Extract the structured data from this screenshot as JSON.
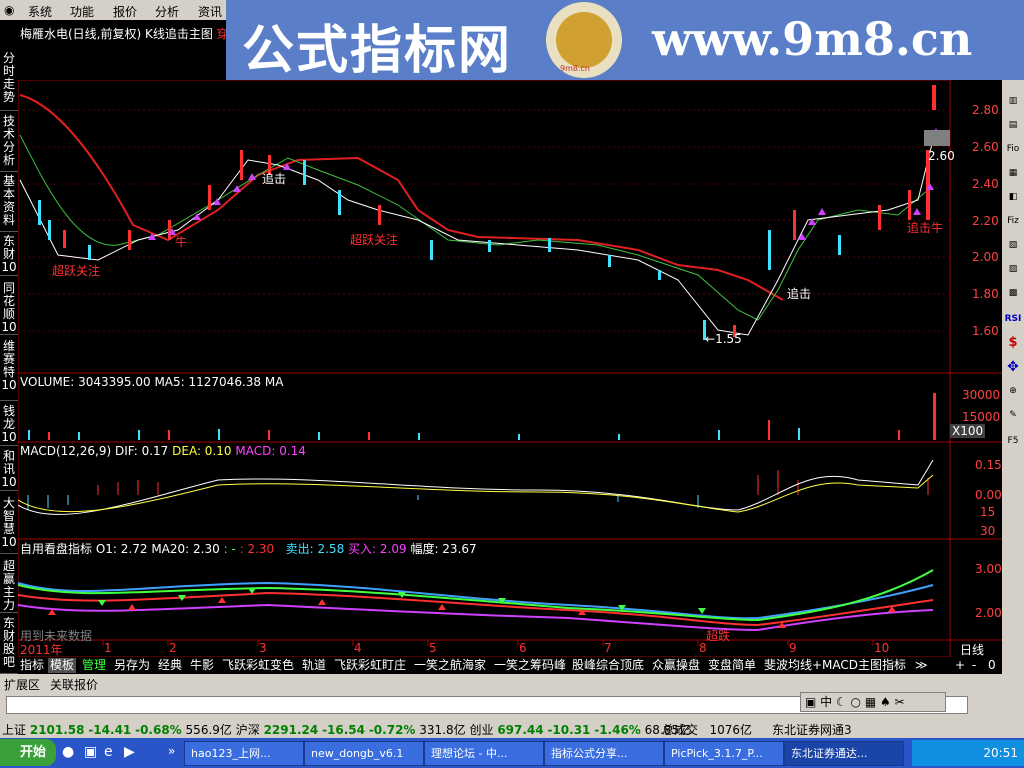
{
  "menu": [
    "系统",
    "功能",
    "报价",
    "分析",
    "资讯"
  ],
  "banner": {
    "title": "公式指标网",
    "url": "www.9m8.cn",
    "logo_text": "9m8.cn"
  },
  "chart_title": "梅雁水电(日线,前复权) K线追击主图",
  "chart_title_extra": "穿",
  "side_tabs": [
    "分时走势",
    "技术分析",
    "基本资料",
    "东财10",
    "同花顺10",
    "维赛特10",
    "钱龙10",
    "和讯10",
    "大智慧10",
    "超赢主力",
    "东财股吧"
  ],
  "price_axis": [
    "2.80",
    "2.60",
    "2.40",
    "2.20",
    "2.00",
    "1.80",
    "1.60"
  ],
  "price_annotations": {
    "last": "2.60",
    "low": "1.55"
  },
  "chart_labels": {
    "zhuiji": "追击",
    "niu": "牛",
    "chaoyue": "超跃关注",
    "zhuijiniu": "追击牛"
  },
  "volume": {
    "header": "VOLUME: 3043395.00  MA5: 1127046.38  MA",
    "axis": [
      "30000",
      "15000"
    ],
    "unit": "X100"
  },
  "macd": {
    "name": "MACD(12,26,9)",
    "dif": "DIF: 0.17",
    "dea": "DEA: 0.10",
    "macd": "MACD: 0.14",
    "axis": [
      "0.15",
      "0.00",
      "15",
      "30"
    ]
  },
  "custom": {
    "name": "自用看盘指标",
    "o1": "O1: 2.72",
    "ma20": "MA20: 2.30",
    "sep": ": -",
    "val": ": 2.30",
    "sell": "卖出: 2.58",
    "buy": "买入: 2.09",
    "range": "幅度: 23.67",
    "axis": [
      "3.00",
      "2.00"
    ],
    "future_note": "用到未来数据",
    "marker": "超跌"
  },
  "time_axis": {
    "labels": [
      "2011年",
      "1",
      "2",
      "3",
      "4",
      "5",
      "6",
      "7",
      "8",
      "9",
      "10"
    ],
    "period": "日线"
  },
  "bottom_tabs": [
    "指标",
    "模板",
    "管理",
    "另存为",
    "经典",
    "牛影",
    "飞跃彩虹变色",
    "轨道",
    "飞跃彩虹盯庄",
    "一笑之航海家",
    "一笑之筹码峰",
    "股峰综合顶底",
    "众赢操盘",
    "变盘简单",
    "斐波均线+MACD主图指标"
  ],
  "ext_tabs": [
    "扩展区",
    "关联报价"
  ],
  "right_tools": [
    "Fio",
    "Fiz",
    "RSI",
    "$",
    "F5"
  ],
  "status": {
    "sh_name": "上证",
    "sh_val": "2101.58",
    "sh_chg": "-14.41",
    "sh_pct": "-0.68%",
    "sh_amt": "556.9亿",
    "sz_name": "沪深",
    "sz_val": "2291.24",
    "sz_chg": "-16.54",
    "sz_pct": "-0.72%",
    "sz_amt": "331.8亿",
    "cy_name": "创业",
    "cy_val": "697.44",
    "cy_chg": "-10.31",
    "cy_pct": "-1.46%",
    "cy_amt": "68.85亿",
    "total_label": "总成交",
    "total_val": "1076亿",
    "broker": "东北证券网通3"
  },
  "taskbar": {
    "start": "开始",
    "items": [
      "hao123_上网...",
      "new_dongb_v6.1",
      "理想论坛 - 中...",
      "指标公式分享...",
      "PicPick_3.1.7_P...",
      "东北证券通达..."
    ],
    "clock": "20:51"
  },
  "colors": {
    "up": "#ff3030",
    "down": "#40e0ff",
    "ma_red": "#e02020",
    "ma_green": "#40c040",
    "signal": "#d040ff"
  }
}
